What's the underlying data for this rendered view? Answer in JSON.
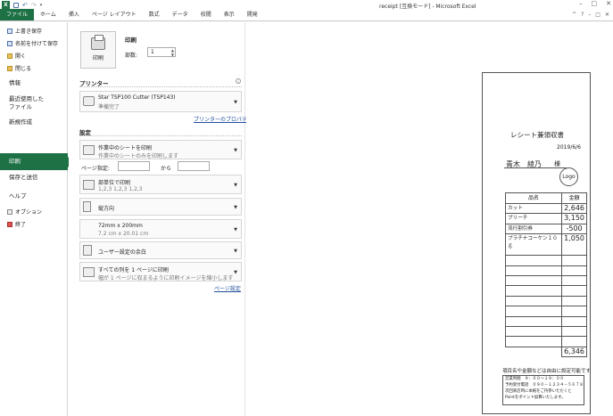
{
  "window": {
    "title": "receipt  [互換モード]  -  Microsoft Excel",
    "app_icon": "X",
    "controls": [
      "–",
      "□",
      "✕"
    ]
  },
  "quick_access": [
    "save-icon",
    "undo-icon",
    "redo-icon",
    "customize-icon"
  ],
  "ribbon": {
    "tabs": [
      {
        "label": "ファイル",
        "active": true
      },
      {
        "label": "ホーム"
      },
      {
        "label": "挿入"
      },
      {
        "label": "ページ レイアウト"
      },
      {
        "label": "数式"
      },
      {
        "label": "データ"
      },
      {
        "label": "校閲"
      },
      {
        "label": "表示"
      },
      {
        "label": "開発"
      }
    ],
    "right_controls": [
      "^",
      "?",
      "–",
      "□",
      "✕"
    ]
  },
  "sidebar": {
    "small_items": [
      "上書き保存",
      "名前を付けて保存",
      "開く",
      "閉じる"
    ],
    "info": "情報",
    "recent_l1": "最近使用した",
    "recent_l2": "ファイル",
    "new": "新規作成",
    "print": "印刷",
    "save_send": "保存と送信",
    "help": "ヘルプ",
    "options": "オプション",
    "exit": "終了"
  },
  "print_panel": {
    "title": "印刷",
    "print_button": "印刷",
    "copies_label": "部数:",
    "copies_value": "1",
    "printer_section": "プリンター",
    "printer_name": "Star TSP100 Cutter (TSP143)",
    "printer_status": "準備完了",
    "printer_properties": "プリンターのプロパティ",
    "settings_section": "設定",
    "scope_l1": "作業中のシートを印刷",
    "scope_l2": "作業中のシートのみを印刷します",
    "pages_label": "ページ指定:",
    "pages_to": "から",
    "collate_l1": "部単位で印刷",
    "collate_l2": "1,2,3    1,2,3    1,2,3",
    "orientation": "縦方向",
    "paper_l1": "72mm x 200mm",
    "paper_l2": "7.2 cm x 20.01 cm",
    "margins": "ユーザー設定の余白",
    "scaling_l1": "すべての列を 1 ページに印刷",
    "scaling_l2": "幅が 1 ページに収まるように印刷イメージを縮小します",
    "page_setup": "ページ設定"
  },
  "receipt": {
    "title": "レシート兼領収書",
    "date": "2019/6/6",
    "customer": "青木　綾乃",
    "honorific": "様",
    "logo": "Logo",
    "col_item": "品名",
    "col_amount": "金額",
    "rows": [
      {
        "item": "カット",
        "amount": "2,646"
      },
      {
        "item": "ブリーチ",
        "amount": "3,150"
      },
      {
        "item": "流行割引券",
        "amount": "-500"
      },
      {
        "item": "プラチナコーケン１０ｇ",
        "amount": "1,050"
      }
    ],
    "total": "6,346",
    "note": "項目名や金額などは自由に設定可能です",
    "footer": [
      "営業時間　９：００〜１９：００",
      "予約受付電話　０９０－１２３４－５６７８",
      "次回来店時に本紙をご持参いただくと",
      "Pointをポイント加算いたします。"
    ]
  },
  "colors": {
    "accent": "#1e7145",
    "link": "#1f4e9c"
  }
}
